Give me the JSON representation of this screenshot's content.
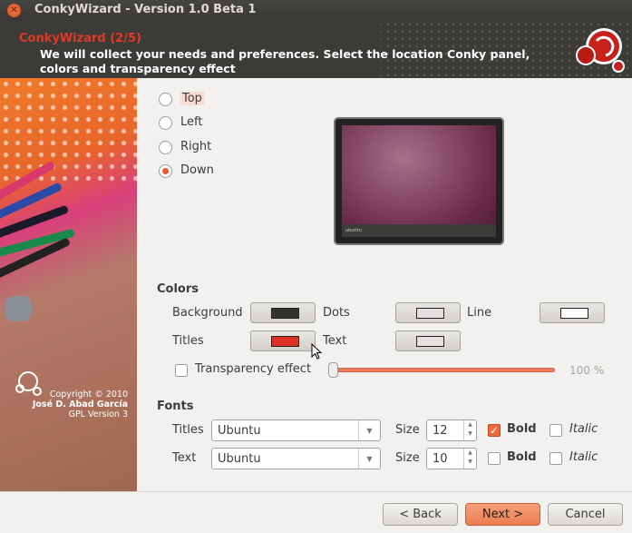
{
  "window": {
    "title": "ConkyWizard - Version 1.0 Beta 1",
    "close_icon": "close-icon"
  },
  "header": {
    "title": "ConkyWizard (2/5)",
    "description": "We will collect your needs and preferences. Select the location Conky panel, colors and transparency effect"
  },
  "sidebar": {
    "copyright": "Copyright © 2010",
    "author": "José D. Abad García",
    "license": "GPL Version 3"
  },
  "position": {
    "options": [
      "Top",
      "Left",
      "Right",
      "Down"
    ],
    "selected": "Down"
  },
  "preview": {
    "panel_text": "ubuntu"
  },
  "colors": {
    "heading": "Colors",
    "background_label": "Background",
    "background_color": "#333330",
    "dots_label": "Dots",
    "dots_color": "#e8e0e0",
    "line_label": "Line",
    "line_color": "#ffffff",
    "titles_label": "Titles",
    "titles_color": "#dd3322",
    "text_label": "Text",
    "text_color": "#e8e0e0",
    "transparency_label": "Transparency effect",
    "transparency_enabled": false,
    "transparency_value": "100 %",
    "transparency_percent": 0
  },
  "fonts": {
    "heading": "Fonts",
    "titles_label": "Titles",
    "titles_font": "Ubuntu",
    "titles_size_label": "Size",
    "titles_size": "12",
    "titles_bold": true,
    "titles_italic": false,
    "text_label": "Text",
    "text_font": "Ubuntu",
    "text_size_label": "Size",
    "text_size": "10",
    "text_bold": false,
    "text_italic": false,
    "bold_label": "Bold",
    "italic_label": "Italic"
  },
  "buttons": {
    "back": "< Back",
    "next": "Next >",
    "cancel": "Cancel"
  }
}
